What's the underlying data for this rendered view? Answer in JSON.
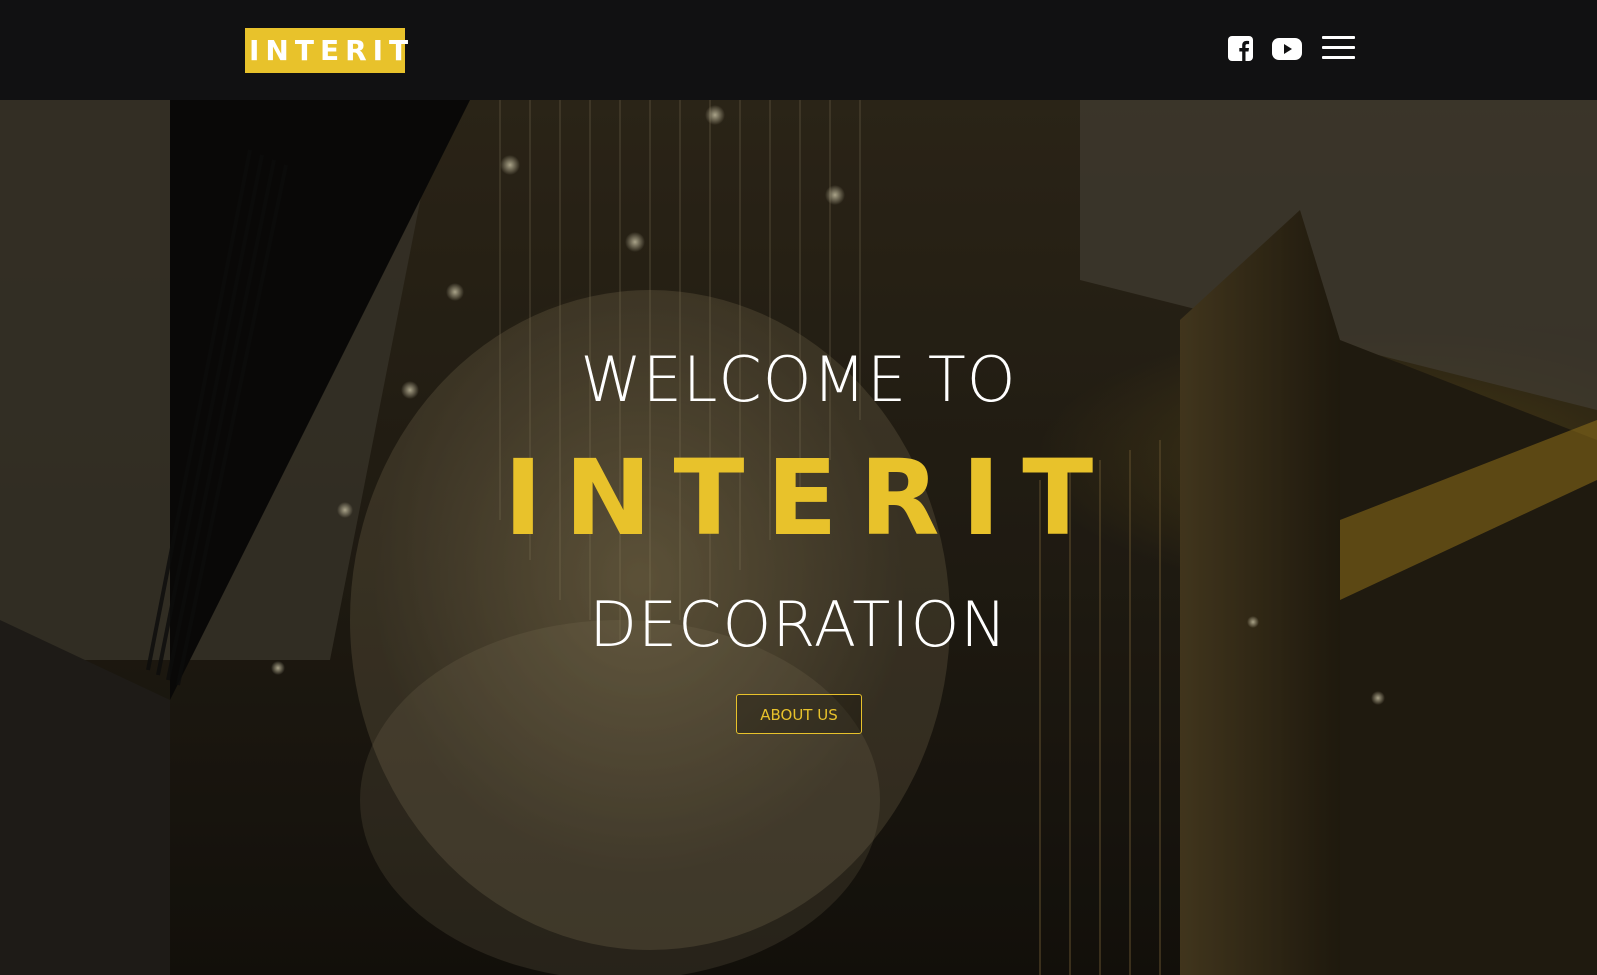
{
  "header": {
    "logo_text": "INTERIT",
    "social_icons": [
      "facebook-icon",
      "youtube-icon"
    ],
    "menu_icon": "hamburger-menu-icon"
  },
  "hero": {
    "welcome_text": "WELCOME TO",
    "brand_text": "INTERIT",
    "subtitle_text": "DECORATION",
    "about_button_label": "ABOUT US",
    "background": "dark interior photo with glass chandelier"
  },
  "colors": {
    "accent": "#e8c22b",
    "header_bg": "#111112",
    "text_light": "#ffffff"
  }
}
